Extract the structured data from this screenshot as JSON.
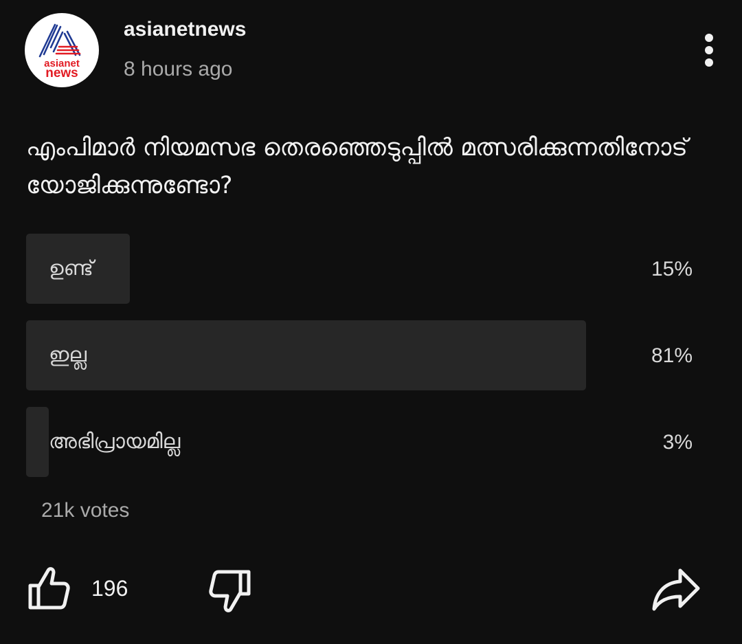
{
  "post": {
    "channel": {
      "name": "asianetnews",
      "avatar_icon": "asianet-news-logo",
      "logo_text_top": "asianet",
      "logo_text_bottom": "news"
    },
    "timestamp": "8 hours ago",
    "menu_icon": "more-vertical-icon"
  },
  "poll": {
    "question": "എംപിമാർ നിയമസഭ തെരഞ്ഞെടുപ്പിൽ മത്സരിക്കുന്നതിനോട് യോജിക്കുന്നുണ്ടോ?",
    "options": [
      {
        "label": "ഉണ്ട്",
        "percent": "15%",
        "share": 0.15
      },
      {
        "label": "ഇല്ല",
        "percent": "81%",
        "share": 0.81
      },
      {
        "label": "അഭിപ്രായമില്ല",
        "percent": "3%",
        "share": 0.03
      }
    ],
    "votes": "21k votes"
  },
  "actions": {
    "like_icon": "thumbs-up-icon",
    "like_count": "196",
    "dislike_icon": "thumbs-down-icon",
    "share_icon": "share-icon"
  },
  "colors": {
    "background": "#0f0f0f",
    "bar_fill": "#272727",
    "text_primary": "#f1f1f1",
    "text_secondary": "#aaaaaa",
    "logo_blue": "#1f3a93",
    "logo_red": "#e21b23"
  }
}
